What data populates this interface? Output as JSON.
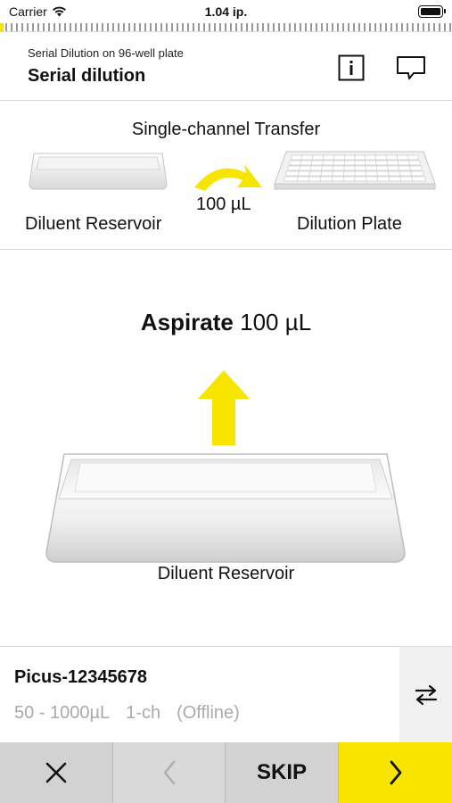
{
  "status_bar": {
    "carrier": "Carrier",
    "time": "1.04 ip."
  },
  "header": {
    "subtitle": "Serial Dilution on 96-well plate",
    "title": "Serial dilution",
    "info_icon": "info-icon",
    "chat_icon": "chat-bubble-icon"
  },
  "overview": {
    "title": "Single-channel Transfer",
    "source_label": "Diluent Reservoir",
    "amount": "100 µL",
    "destination_label": "Dilution Plate"
  },
  "step": {
    "action": "Aspirate",
    "amount": "100 µL",
    "vessel_label": "Diluent Reservoir"
  },
  "device": {
    "name": "Picus-12345678",
    "range": "50 - 1000µL",
    "channels": "1-ch",
    "status": "(Offline)"
  },
  "bottom_bar": {
    "skip_label": "SKIP"
  },
  "colors": {
    "accent_yellow": "#f7e500",
    "button_gray": "#d2d2d2",
    "muted_text": "#aaaaaa"
  }
}
